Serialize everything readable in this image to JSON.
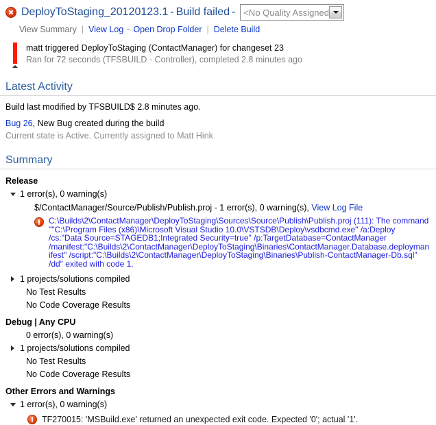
{
  "header": {
    "status_icon": "error-circle-icon",
    "build_name": "DeployToStaging_20120123.1",
    "dash": "-",
    "status_text": "Build failed",
    "dash2": "-",
    "quality_value": "<No Quality Assigned>",
    "dropdown_icon": "chevron-down-icon",
    "accent_color": "#1f4e96",
    "error_color": "#e23b14"
  },
  "linkbar": {
    "view_summary": "View Summary",
    "pipe1": "|",
    "view_log": "View Log",
    "dash": "-",
    "open_drop_folder": "Open Drop Folder",
    "pipe2": "|",
    "delete_build": "Delete Build"
  },
  "trigger": {
    "main": "matt triggered DeployToStaging (ContactManager) for changeset 23",
    "sub": "Ran for 72 seconds (TFSBUILD - Controller), completed 2.8 minutes ago"
  },
  "latest_activity": {
    "heading": "Latest Activity",
    "modified_line": "Build last modified by TFSBUILD$ 2.8 minutes ago.",
    "bug_link": "Bug 26",
    "bug_rest": ", New Bug created during the build",
    "bug_state": "Current state is Active. Currently assigned to Matt Hink"
  },
  "summary": {
    "heading": "Summary",
    "release": {
      "title": "Release",
      "counts": "1 error(s), 0 warning(s)",
      "project_line": "$/ContactManager/Source/Publish/Publish.proj - 1 error(s), 0 warning(s),",
      "view_log_file": "View Log File",
      "error_text": "C:\\Builds\\2\\ContactManager\\DeployToStaging\\Sources\\Source\\Publish\\Publish.proj (111): The command \"\"C:\\Program Files (x86)\\Microsoft Visual Studio 10.0\\VSTSDB\\Deploy\\vsdbcmd.exe\" /a:Deploy /cs:\"Data Source=STAGEDB1;Integrated Security=true\" /p:TargetDatabase=ContactManager /manifest:\"C:\\Builds\\2\\ContactManager\\DeployToStaging\\Binaries\\ContactManager.Database.deploymanifest\" /script:\"C:\\Builds\\2\\ContactManager\\DeployToStaging\\Binaries\\Publish-ContactManager-Db.sql\" /dd\" exited with code 1.",
      "projects_compiled": "1 projects/solutions compiled",
      "no_test_results": "No Test Results",
      "no_code_coverage": "No Code Coverage Results"
    },
    "debug": {
      "title": "Debug | Any CPU",
      "counts": "0 error(s), 0 warning(s)",
      "projects_compiled": "1 projects/solutions compiled",
      "no_test_results": "No Test Results",
      "no_code_coverage": "No Code Coverage Results"
    },
    "other": {
      "title": "Other Errors and Warnings",
      "counts": "1 error(s), 0 warning(s)",
      "error_text": "TF270015: 'MSBuild.exe' returned an unexpected exit code. Expected '0'; actual '1'."
    }
  }
}
